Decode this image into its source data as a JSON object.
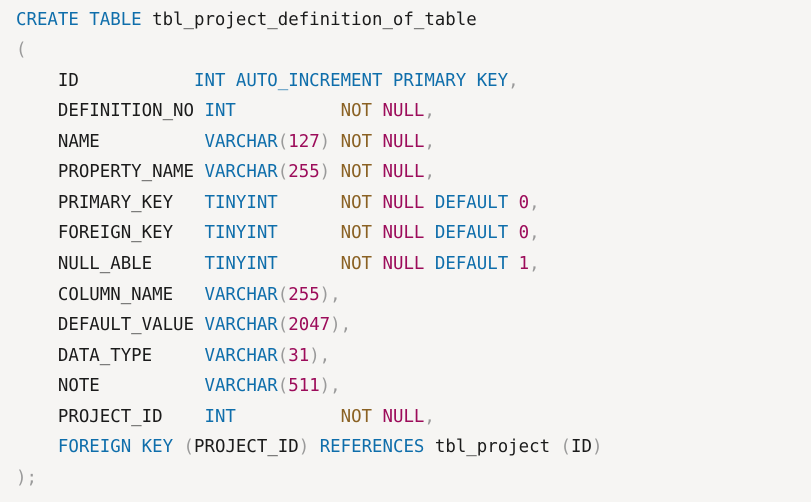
{
  "code": {
    "lines": [
      [
        {
          "t": "CREATE TABLE",
          "c": "kw"
        },
        {
          "t": " tbl_project_definition_of_table",
          "c": "id"
        }
      ],
      [
        {
          "t": "(",
          "c": "pn"
        }
      ],
      [
        {
          "t": "    ID           ",
          "c": "id"
        },
        {
          "t": "INT AUTO_INCREMENT PRIMARY KEY",
          "c": "kw"
        },
        {
          "t": ",",
          "c": "pn"
        }
      ],
      [
        {
          "t": "    DEFINITION_NO ",
          "c": "id"
        },
        {
          "t": "INT",
          "c": "ty"
        },
        {
          "t": "          ",
          "c": "id"
        },
        {
          "t": "NOT",
          "c": "nt"
        },
        {
          "t": " ",
          "c": "id"
        },
        {
          "t": "NULL",
          "c": "nl"
        },
        {
          "t": ",",
          "c": "pn"
        }
      ],
      [
        {
          "t": "    NAME          ",
          "c": "id"
        },
        {
          "t": "VARCHAR",
          "c": "ty"
        },
        {
          "t": "(",
          "c": "pn"
        },
        {
          "t": "127",
          "c": "num"
        },
        {
          "t": ")",
          "c": "pn"
        },
        {
          "t": " ",
          "c": "id"
        },
        {
          "t": "NOT",
          "c": "nt"
        },
        {
          "t": " ",
          "c": "id"
        },
        {
          "t": "NULL",
          "c": "nl"
        },
        {
          "t": ",",
          "c": "pn"
        }
      ],
      [
        {
          "t": "    PROPERTY_NAME ",
          "c": "id"
        },
        {
          "t": "VARCHAR",
          "c": "ty"
        },
        {
          "t": "(",
          "c": "pn"
        },
        {
          "t": "255",
          "c": "num"
        },
        {
          "t": ")",
          "c": "pn"
        },
        {
          "t": " ",
          "c": "id"
        },
        {
          "t": "NOT",
          "c": "nt"
        },
        {
          "t": " ",
          "c": "id"
        },
        {
          "t": "NULL",
          "c": "nl"
        },
        {
          "t": ",",
          "c": "pn"
        }
      ],
      [
        {
          "t": "    PRIMARY_KEY   ",
          "c": "id"
        },
        {
          "t": "TINYINT",
          "c": "ty"
        },
        {
          "t": "      ",
          "c": "id"
        },
        {
          "t": "NOT",
          "c": "nt"
        },
        {
          "t": " ",
          "c": "id"
        },
        {
          "t": "NULL",
          "c": "nl"
        },
        {
          "t": " ",
          "c": "id"
        },
        {
          "t": "DEFAULT",
          "c": "kw"
        },
        {
          "t": " ",
          "c": "id"
        },
        {
          "t": "0",
          "c": "num"
        },
        {
          "t": ",",
          "c": "pn"
        }
      ],
      [
        {
          "t": "    FOREIGN_KEY   ",
          "c": "id"
        },
        {
          "t": "TINYINT",
          "c": "ty"
        },
        {
          "t": "      ",
          "c": "id"
        },
        {
          "t": "NOT",
          "c": "nt"
        },
        {
          "t": " ",
          "c": "id"
        },
        {
          "t": "NULL",
          "c": "nl"
        },
        {
          "t": " ",
          "c": "id"
        },
        {
          "t": "DEFAULT",
          "c": "kw"
        },
        {
          "t": " ",
          "c": "id"
        },
        {
          "t": "0",
          "c": "num"
        },
        {
          "t": ",",
          "c": "pn"
        }
      ],
      [
        {
          "t": "    NULL_ABLE     ",
          "c": "id"
        },
        {
          "t": "TINYINT",
          "c": "ty"
        },
        {
          "t": "      ",
          "c": "id"
        },
        {
          "t": "NOT",
          "c": "nt"
        },
        {
          "t": " ",
          "c": "id"
        },
        {
          "t": "NULL",
          "c": "nl"
        },
        {
          "t": " ",
          "c": "id"
        },
        {
          "t": "DEFAULT",
          "c": "kw"
        },
        {
          "t": " ",
          "c": "id"
        },
        {
          "t": "1",
          "c": "num"
        },
        {
          "t": ",",
          "c": "pn"
        }
      ],
      [
        {
          "t": "    COLUMN_NAME   ",
          "c": "id"
        },
        {
          "t": "VARCHAR",
          "c": "ty"
        },
        {
          "t": "(",
          "c": "pn"
        },
        {
          "t": "255",
          "c": "num"
        },
        {
          "t": "),",
          "c": "pn"
        }
      ],
      [
        {
          "t": "    DEFAULT_VALUE ",
          "c": "id"
        },
        {
          "t": "VARCHAR",
          "c": "ty"
        },
        {
          "t": "(",
          "c": "pn"
        },
        {
          "t": "2047",
          "c": "num"
        },
        {
          "t": "),",
          "c": "pn"
        }
      ],
      [
        {
          "t": "    DATA_TYPE     ",
          "c": "id"
        },
        {
          "t": "VARCHAR",
          "c": "ty"
        },
        {
          "t": "(",
          "c": "pn"
        },
        {
          "t": "31",
          "c": "num"
        },
        {
          "t": "),",
          "c": "pn"
        }
      ],
      [
        {
          "t": "    NOTE          ",
          "c": "id"
        },
        {
          "t": "VARCHAR",
          "c": "ty"
        },
        {
          "t": "(",
          "c": "pn"
        },
        {
          "t": "511",
          "c": "num"
        },
        {
          "t": "),",
          "c": "pn"
        }
      ],
      [
        {
          "t": "    PROJECT_ID    ",
          "c": "id"
        },
        {
          "t": "INT",
          "c": "ty"
        },
        {
          "t": "          ",
          "c": "id"
        },
        {
          "t": "NOT",
          "c": "nt"
        },
        {
          "t": " ",
          "c": "id"
        },
        {
          "t": "NULL",
          "c": "nl"
        },
        {
          "t": ",",
          "c": "pn"
        }
      ],
      [
        {
          "t": "    ",
          "c": "id"
        },
        {
          "t": "FOREIGN KEY",
          "c": "kw"
        },
        {
          "t": " ",
          "c": "id"
        },
        {
          "t": "(",
          "c": "pn"
        },
        {
          "t": "PROJECT_ID",
          "c": "id"
        },
        {
          "t": ")",
          "c": "pn"
        },
        {
          "t": " ",
          "c": "id"
        },
        {
          "t": "REFERENCES",
          "c": "kw"
        },
        {
          "t": " tbl_project ",
          "c": "id"
        },
        {
          "t": "(",
          "c": "pn"
        },
        {
          "t": "ID",
          "c": "id"
        },
        {
          "t": ")",
          "c": "pn"
        }
      ],
      [
        {
          "t": ");",
          "c": "pn"
        }
      ]
    ]
  },
  "colors": {
    "background": "#f6f5f3",
    "keyword": "#0f6eab",
    "number": "#9c0c5a",
    "not": "#8a6123",
    "null": "#9c0c5a",
    "punctuation": "#9a9a9a",
    "identifier": "#1b1b1b"
  }
}
